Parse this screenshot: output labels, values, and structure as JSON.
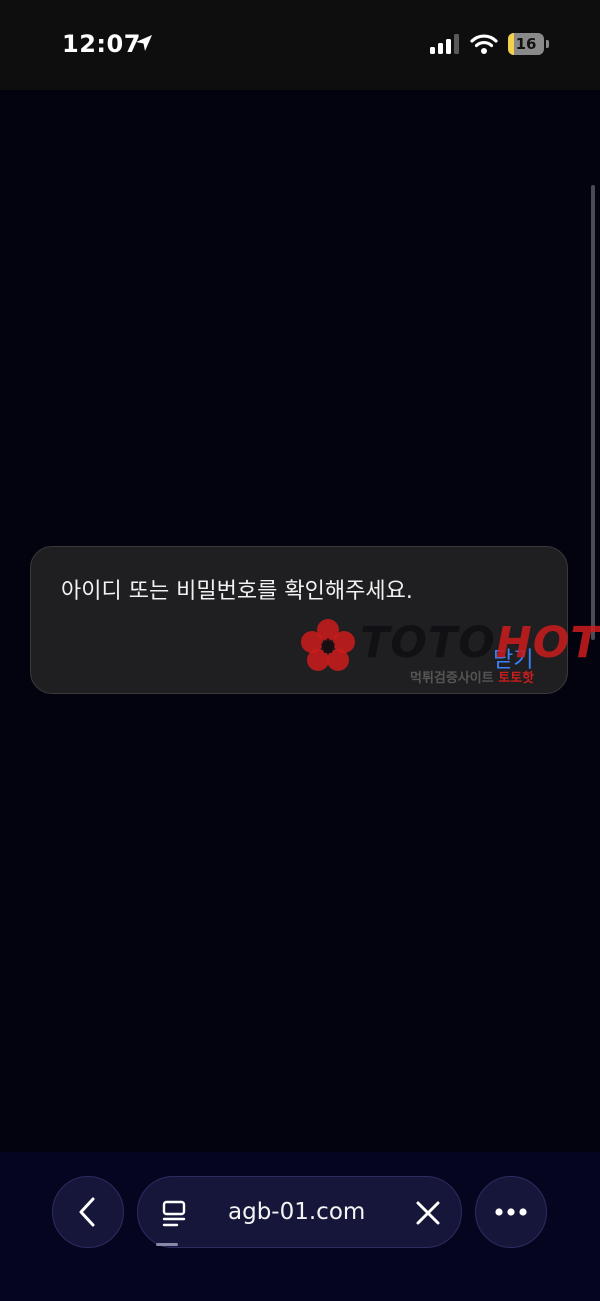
{
  "status_bar": {
    "time": "12:07",
    "battery_level": 16,
    "battery_fraction": 0.16,
    "location_icon": "location-arrow-icon",
    "signal_icon": "cellular-signal-icon",
    "wifi_icon": "wifi-icon"
  },
  "alert": {
    "message": "아이디 또는 비밀번호를 확인해주세요.",
    "close_label": "닫기"
  },
  "watermark": {
    "brand_dark": "TOTO",
    "brand_red": "HOT",
    "tagline_prefix": "먹튀검증사이트 ",
    "tagline_brand": "토토핫"
  },
  "toolbar": {
    "url": "agb-01.com",
    "back_icon": "chevron-left-icon",
    "page_icon": "page-menu-icon",
    "clear_icon": "close-icon",
    "more_icon": "more-dots-icon"
  },
  "colors": {
    "background": "#03030f",
    "alert_bg": "#1f1f21",
    "link_blue": "#3b82f6",
    "toolbar_bg": "#05051f",
    "watermark_red": "#cd1c1c",
    "battery_yellow": "#f5d24a"
  }
}
